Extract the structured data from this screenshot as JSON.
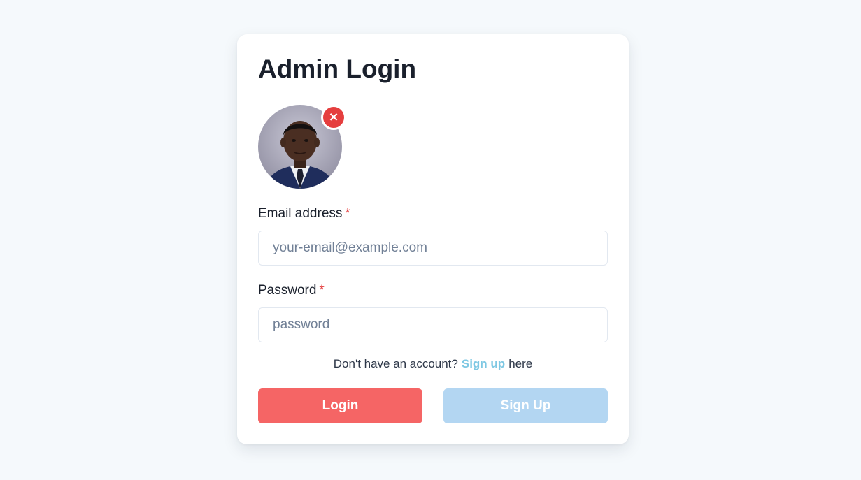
{
  "title": "Admin Login",
  "avatar": {
    "remove_icon": "close-icon",
    "remove_glyph": "×"
  },
  "email": {
    "label": "Email address",
    "required_mark": "*",
    "placeholder": "your-email@example.com",
    "value": ""
  },
  "password": {
    "label": "Password",
    "required_mark": "*",
    "placeholder": "password",
    "value": ""
  },
  "signup_hint": {
    "prefix": "Don't have an account?",
    "link": "Sign up",
    "suffix": "here"
  },
  "buttons": {
    "login": "Login",
    "signup": "Sign Up"
  },
  "colors": {
    "accent_red": "#f56565",
    "danger": "#e53e3e",
    "signup_disabled": "#b3d6f2",
    "link": "#7ec8e3"
  }
}
